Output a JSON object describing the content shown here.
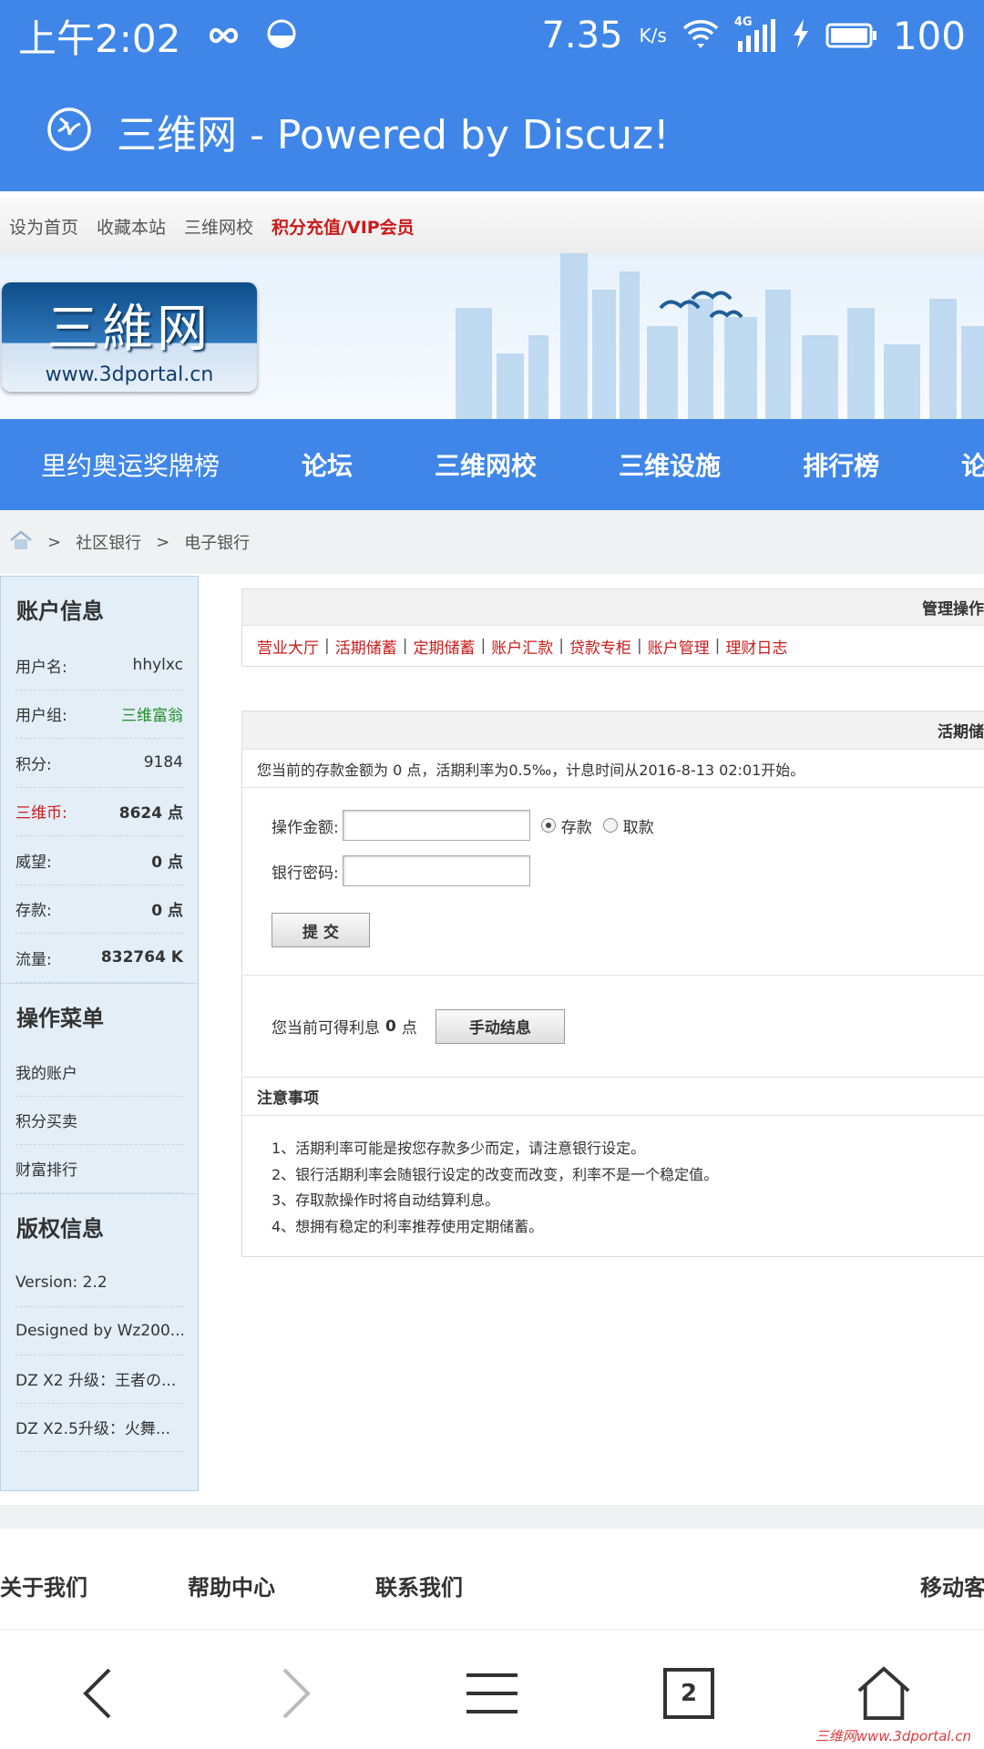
{
  "status_bar": {
    "time": "上午2:02",
    "speed": "7.35",
    "speed_unit": "K/s",
    "net": "4G",
    "battery": "100"
  },
  "browser": {
    "title": "三维网 - Powered by Discuz!"
  },
  "top_links": [
    "设为首页",
    "收藏本站",
    "三维网校"
  ],
  "top_vip": "积分充值/VIP会员",
  "banner": {
    "logo_text": "三維网",
    "logo_url": "www.3dportal.cn"
  },
  "main_nav": [
    "里约奥运奖牌榜",
    "论坛",
    "三维网校",
    "三维设施",
    "排行榜",
    "论"
  ],
  "breadcrumb": {
    "level1": "社区银行",
    "level2": "电子银行",
    "sep": ">"
  },
  "sidebar": {
    "account_title": "账户信息",
    "rows": [
      {
        "label": "用户名:",
        "value": "hhylxc"
      },
      {
        "label": "用户组:",
        "value": "三维富翁"
      },
      {
        "label": "积分:",
        "value": "9184"
      },
      {
        "label": "三维币:",
        "value": "8624 点"
      },
      {
        "label": "威望:",
        "value": "0 点"
      },
      {
        "label": "存款:",
        "value": "0 点"
      },
      {
        "label": "流量:",
        "value": "832764 K"
      }
    ],
    "menu_title": "操作菜单",
    "menu": [
      "我的账户",
      "积分买卖",
      "财富排行"
    ],
    "copyright_title": "版权信息",
    "copyright": [
      "Version: 2.2",
      "Designed by Wz200...",
      "DZ X2 升级：王者の...",
      "DZ X2.5升级：火舞..."
    ]
  },
  "manage": {
    "header": "管理操作",
    "links": [
      "营业大厅",
      "活期储蓄",
      "定期储蓄",
      "账户汇款",
      "贷款专柜",
      "账户管理",
      "理财日志"
    ],
    "sep": "|"
  },
  "demand": {
    "header": "活期储",
    "info": "您当前的存款金额为 0 点，活期利率为0.5‰，计息时间从2016-8-13 02:01开始。",
    "amount_label": "操作金额:",
    "deposit_label": "存款",
    "withdraw_label": "取款",
    "password_label": "银行密码:",
    "submit_label": "提 交",
    "interest_prefix": "您当前可得利息",
    "interest_value": "0",
    "interest_unit": "点",
    "settle_label": "手动结息"
  },
  "notes": {
    "title": "注意事项",
    "items": [
      "1、活期利率可能是按您存款多少而定，请注意银行设定。",
      "2、银行活期利率会随银行设定的改变而改变，利率不是一个稳定值。",
      "3、存取款操作时将自动结算利息。",
      "4、想拥有稳定的利率推荐使用定期储蓄。"
    ]
  },
  "footer": [
    "关于我们",
    "帮助中心",
    "联系我们",
    "移动客"
  ],
  "bottom_nav": {
    "tab_count": "2"
  },
  "watermark": "三维网www.3dportal.cn"
}
